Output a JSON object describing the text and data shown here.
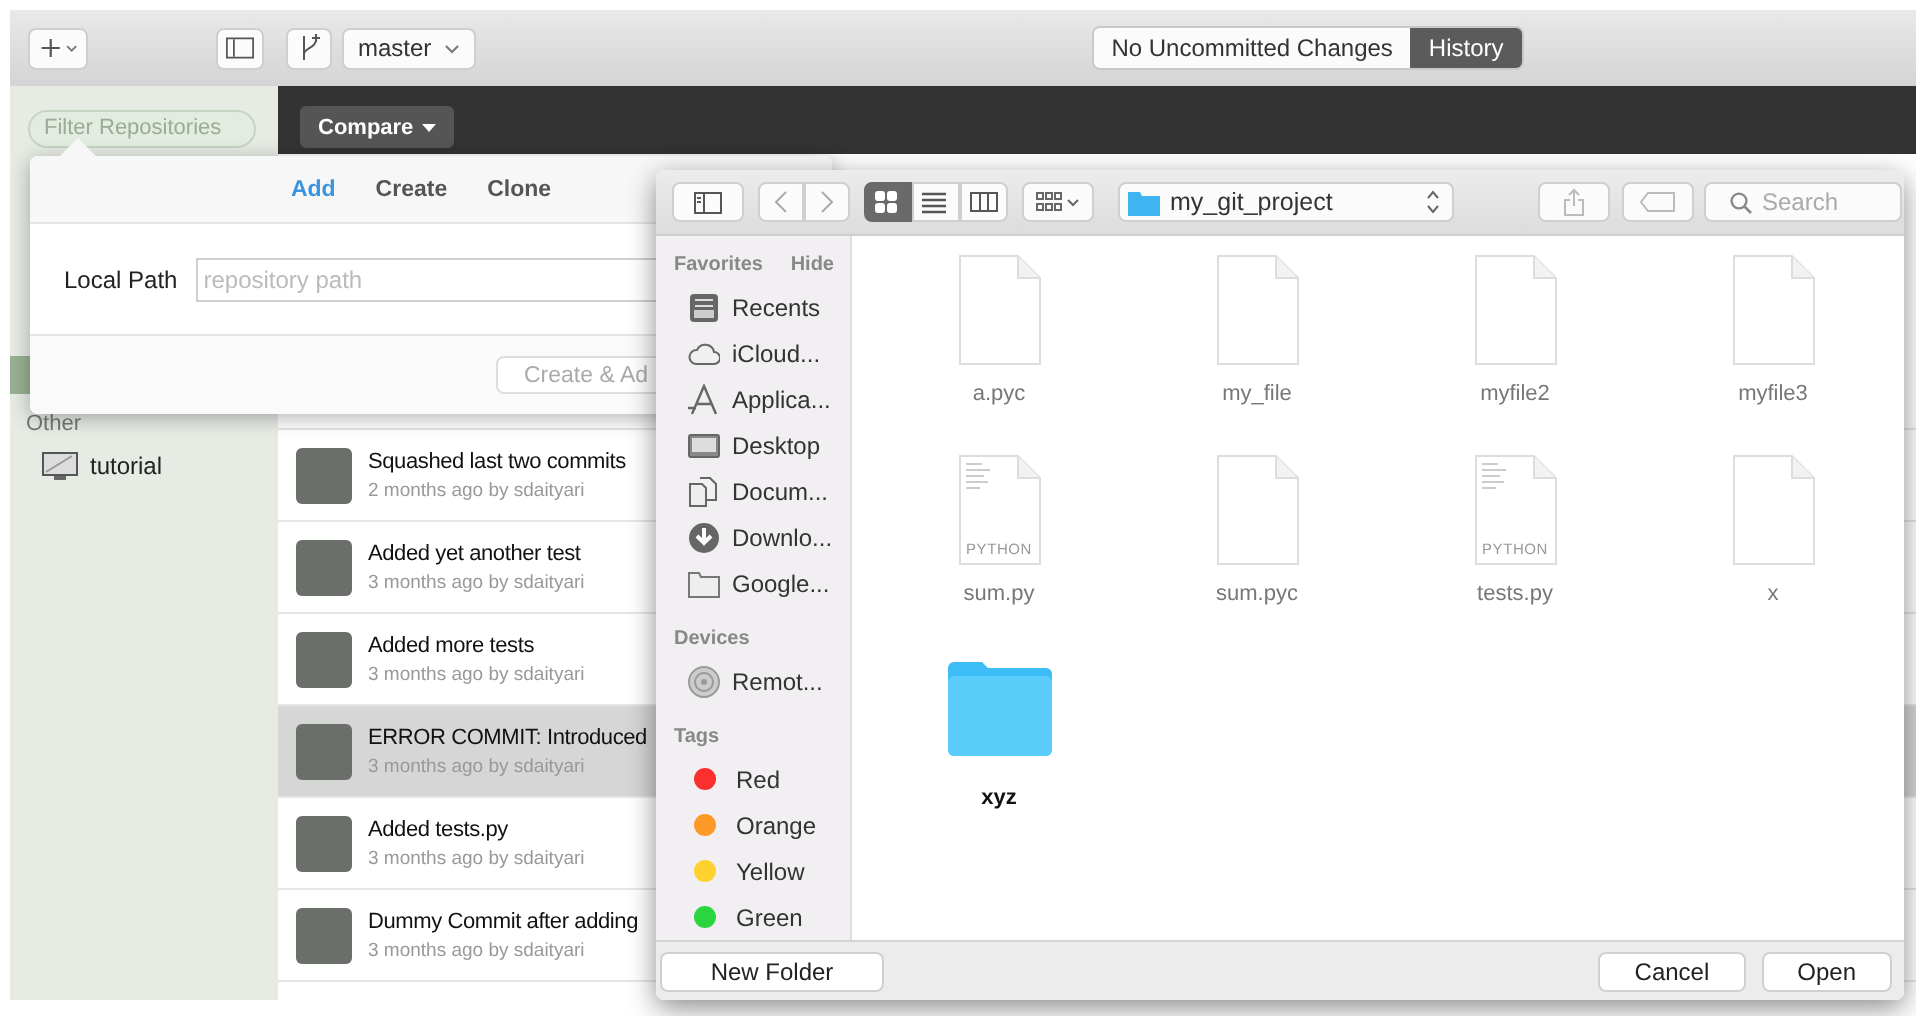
{
  "toolbar": {
    "branch": "master",
    "segments": [
      {
        "label": "No Uncommitted Changes",
        "selected": false
      },
      {
        "label": "History",
        "selected": true
      }
    ]
  },
  "sidebar": {
    "filter_placeholder": "Filter Repositories",
    "groups": [
      {
        "label": "Other",
        "items": [
          {
            "label": "tutorial"
          }
        ]
      }
    ]
  },
  "history": {
    "compare_button": "Compare",
    "commits": [
      {
        "title": "Squashed last two commits",
        "meta": "2 months ago by sdaityari",
        "selected": false
      },
      {
        "title": "Added yet another test",
        "meta": "3 months ago by sdaityari",
        "selected": false
      },
      {
        "title": "Added more tests",
        "meta": "3 months ago by sdaityari",
        "selected": false
      },
      {
        "title": "ERROR COMMIT: Introduced",
        "meta": "3 months ago by sdaityari",
        "selected": true
      },
      {
        "title": "Added tests.py",
        "meta": "3 months ago by sdaityari",
        "selected": false
      },
      {
        "title": "Dummy Commit after adding",
        "meta": "3 months ago by sdaityari",
        "selected": false
      }
    ]
  },
  "add_popover": {
    "tabs": [
      {
        "label": "Add",
        "selected": true
      },
      {
        "label": "Create",
        "selected": false
      },
      {
        "label": "Clone",
        "selected": false
      }
    ],
    "field_label": "Local Path",
    "placeholder": "repository path",
    "button": "Create & Ad"
  },
  "file_dialog": {
    "view_modes": [
      {
        "kind": "icons",
        "selected": true
      },
      {
        "kind": "list",
        "selected": false
      },
      {
        "kind": "columns",
        "selected": false
      }
    ],
    "location": "my_git_project",
    "search_placeholder": "Search",
    "sections": [
      {
        "heading": "Favorites",
        "action": "Hide",
        "items": [
          {
            "kind": "recents",
            "label": "Recents"
          },
          {
            "kind": "cloud",
            "label": "iCloud..."
          },
          {
            "kind": "apps",
            "label": "Applica..."
          },
          {
            "kind": "desktop",
            "label": "Desktop"
          },
          {
            "kind": "documents",
            "label": "Docum..."
          },
          {
            "kind": "downloads",
            "label": "Downlo..."
          },
          {
            "kind": "folder",
            "label": "Google..."
          }
        ]
      },
      {
        "heading": "Devices",
        "items": [
          {
            "kind": "disc",
            "label": "Remot..."
          }
        ]
      },
      {
        "heading": "Tags",
        "items": [
          {
            "kind": "tag",
            "label": "Red",
            "color": "#fc2f2f"
          },
          {
            "kind": "tag",
            "label": "Orange",
            "color": "#fd9a27"
          },
          {
            "kind": "tag",
            "label": "Yellow",
            "color": "#fdd12e"
          },
          {
            "kind": "tag",
            "label": "Green",
            "color": "#2ad53f"
          }
        ]
      }
    ],
    "files": [
      {
        "kind": "file",
        "name": "a.pyc"
      },
      {
        "kind": "file",
        "name": "my_file"
      },
      {
        "kind": "file",
        "name": "myfile2"
      },
      {
        "kind": "file",
        "name": "myfile3"
      },
      {
        "kind": "python",
        "name": "sum.py",
        "badge": "PYTHON"
      },
      {
        "kind": "file",
        "name": "sum.pyc"
      },
      {
        "kind": "python",
        "name": "tests.py",
        "badge": "PYTHON"
      },
      {
        "kind": "file",
        "name": "x"
      },
      {
        "kind": "folder",
        "name": "xyz"
      }
    ],
    "buttons": [
      {
        "kind": "left",
        "label": "New Folder"
      },
      {
        "kind": "right",
        "label": "Cancel"
      },
      {
        "kind": "right",
        "label": "Open"
      }
    ]
  }
}
